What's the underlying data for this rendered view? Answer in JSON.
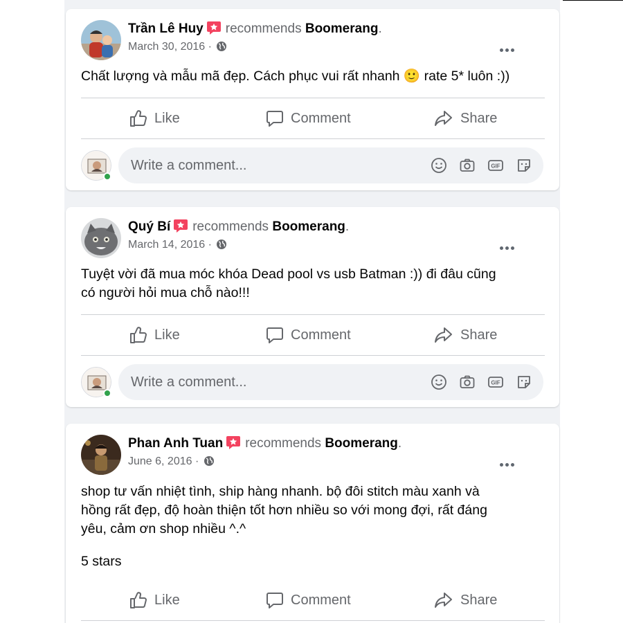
{
  "posts": [
    {
      "author": "Trần Lê Huy",
      "recommends_text": "recommends",
      "page": "Boomerang",
      "page_suffix": ".",
      "date": "March 30, 2016 ·",
      "text": "Chất lượng và mẫu mã đẹp. Cách phục vui rất nhanh 🙂 rate 5* luôn :))",
      "comment_placeholder": "Write a comment..."
    },
    {
      "author": "Quý Bí",
      "recommends_text": "recommends",
      "page": "Boomerang",
      "page_suffix": ".",
      "date": "March 14, 2016 ·",
      "text": "Tuyệt vời đã mua móc khóa Dead pool vs usb Batman :)) đi đâu cũng\ncó người hỏi mua chỗ nào!!!",
      "comment_placeholder": "Write a comment..."
    },
    {
      "author": "Phan Anh Tuan",
      "recommends_text": "recommends",
      "page": "Boomerang",
      "page_suffix": ".",
      "date": "June 6, 2016 ·",
      "text": "shop tư vấn nhiệt tình, ship hàng nhanh. bộ đôi stitch màu xanh và\nhồng rất đẹp, độ hoàn thiện tốt hơn nhiều so với mong đợi, rất đáng\nyêu, cảm ơn shop nhiều ^.^",
      "stars": "5 stars"
    }
  ],
  "actions": {
    "like": "Like",
    "comment": "Comment",
    "share": "Share"
  },
  "colors": {
    "badge": "#f3425f",
    "secondary_text": "#65676b",
    "online": "#31a24c",
    "feed_background": "#f0f2f5"
  },
  "icons": [
    "recommendation-badge-icon",
    "globe-icon",
    "more-options-icon",
    "like-icon",
    "comment-icon",
    "share-icon",
    "emoji-icon",
    "camera-icon",
    "gif-icon",
    "sticker-icon"
  ]
}
